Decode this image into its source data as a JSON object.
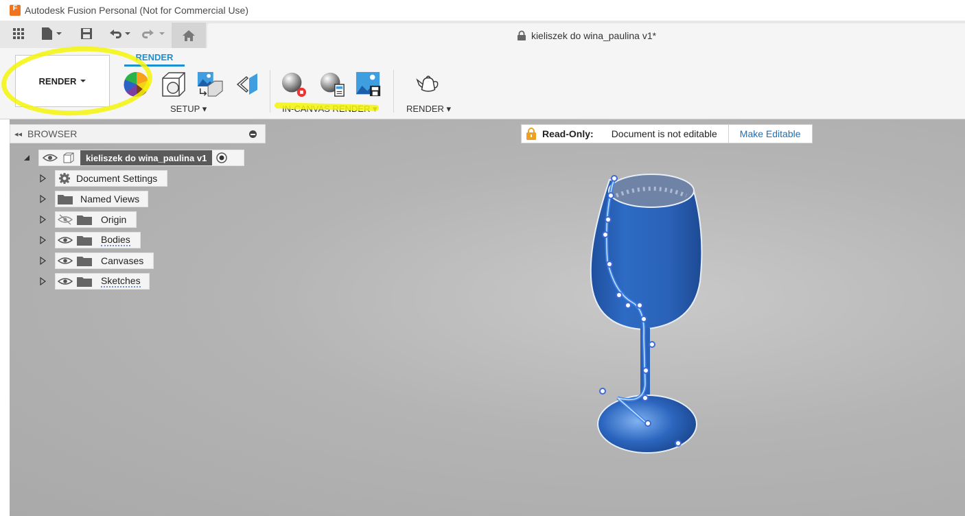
{
  "window": {
    "title": "Autodesk Fusion Personal (Not for Commercial Use)",
    "logo_letter": "F"
  },
  "document": {
    "tab_title": "kieliszek do wina_paulina v1*"
  },
  "ribbon": {
    "workspace_label": "RENDER",
    "active_tab": "RENDER",
    "groups": [
      {
        "label": "SETUP"
      },
      {
        "label": "IN-CANVAS RENDER"
      },
      {
        "label": "RENDER"
      }
    ]
  },
  "browser": {
    "title": "BROWSER",
    "root": "kieliszek do wina_paulina v1",
    "items": [
      {
        "label": "Document Settings"
      },
      {
        "label": "Named Views"
      },
      {
        "label": "Origin"
      },
      {
        "label": "Bodies"
      },
      {
        "label": "Canvases"
      },
      {
        "label": "Sketches"
      }
    ]
  },
  "readonly": {
    "label": "Read-Only:",
    "message": "Document is not editable",
    "action": "Make Editable"
  },
  "colors": {
    "accent": "#1a90d0",
    "highlighter": "#f5f50a",
    "glass": "#2a62b8"
  }
}
